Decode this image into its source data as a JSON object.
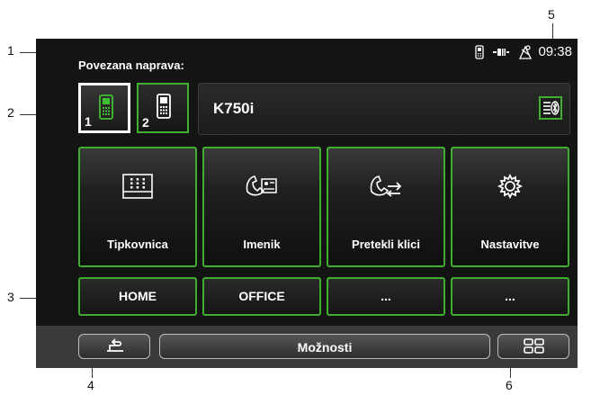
{
  "callouts": [
    "1",
    "2",
    "3",
    "4",
    "5",
    "6"
  ],
  "status": {
    "icons": [
      "phone-signal-icon",
      "battery-icon",
      "satellite-icon"
    ],
    "time": "09:38"
  },
  "device": {
    "label": "Povezana naprava:",
    "phone1": "1",
    "phone2": "2",
    "connected_name": "K750i",
    "bluetooth_icon": "bluetooth-phonebook-icon"
  },
  "tiles": [
    {
      "label": "Tipkovnica",
      "icon": "keypad-icon"
    },
    {
      "label": "Imenik",
      "icon": "phonebook-icon"
    },
    {
      "label": "Pretekli klici",
      "icon": "call-history-icon"
    },
    {
      "label": "Nastavitve",
      "icon": "gear-icon"
    }
  ],
  "quick_dial": [
    "HOME",
    "OFFICE",
    "...",
    "..."
  ],
  "bottom": {
    "options_label": "Možnosti",
    "back_icon": "back-arrow-icon",
    "menu_icon": "grid-menu-icon"
  },
  "colors": {
    "accent_green": "#3fae2e",
    "background": "#141414",
    "text": "#ffffff"
  }
}
